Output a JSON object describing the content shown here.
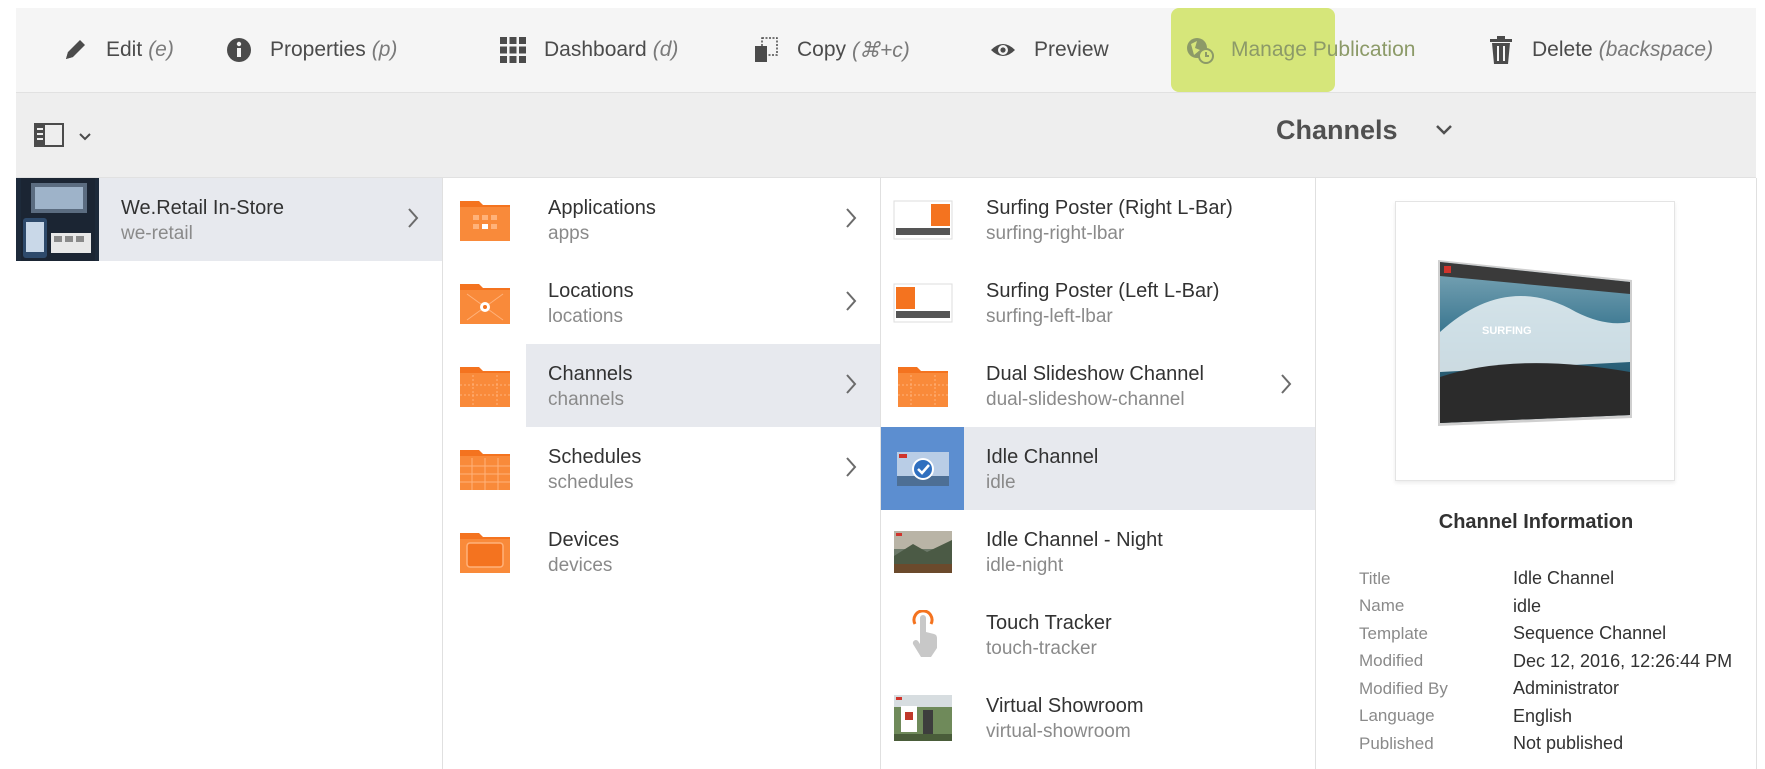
{
  "toolbar": {
    "items": [
      {
        "label": "Edit",
        "shortcut": "(e)",
        "icon": "pencil-icon"
      },
      {
        "label": "Properties",
        "shortcut": "(p)",
        "icon": "info-icon"
      },
      {
        "label": "Dashboard",
        "shortcut": "(d)",
        "icon": "grid-icon"
      },
      {
        "label": "Copy",
        "shortcut": "(⌘+c)",
        "icon": "copy-icon"
      },
      {
        "label": "Preview",
        "shortcut": "",
        "icon": "eye-icon"
      },
      {
        "label": "Manage Publication",
        "shortcut": "",
        "icon": "publication-icon"
      },
      {
        "label": "Delete",
        "shortcut": "(backspace)",
        "icon": "trash-icon"
      }
    ],
    "highlight_color": "#d6e67a"
  },
  "subheader": {
    "title": "Channels",
    "rail_icon": "rail-toggle-icon"
  },
  "columns": {
    "root": [
      {
        "title": "We.Retail In-Store",
        "name": "we-retail"
      }
    ],
    "level2": [
      {
        "title": "Applications",
        "name": "apps"
      },
      {
        "title": "Locations",
        "name": "locations"
      },
      {
        "title": "Channels",
        "name": "channels"
      },
      {
        "title": "Schedules",
        "name": "schedules"
      },
      {
        "title": "Devices",
        "name": "devices"
      }
    ],
    "level3": [
      {
        "title": "Surfing Poster (Right L-Bar)",
        "name": "surfing-right-lbar"
      },
      {
        "title": "Surfing Poster (Left L-Bar)",
        "name": "surfing-left-lbar"
      },
      {
        "title": "Dual Slideshow Channel",
        "name": "dual-slideshow-channel"
      },
      {
        "title": "Idle Channel",
        "name": "idle"
      },
      {
        "title": "Idle Channel - Night",
        "name": "idle-night"
      },
      {
        "title": "Touch Tracker",
        "name": "touch-tracker"
      },
      {
        "title": "Virtual Showroom",
        "name": "virtual-showroom"
      }
    ]
  },
  "preview": {
    "banner_text": "SURFING"
  },
  "info": {
    "heading": "Channel Information",
    "properties": [
      {
        "key": "Title",
        "value": "Idle Channel"
      },
      {
        "key": "Name",
        "value": "idle"
      },
      {
        "key": "Template",
        "value": "Sequence Channel"
      },
      {
        "key": "Modified",
        "value": "Dec 12, 2016, 12:26:44 PM"
      },
      {
        "key": "Modified By",
        "value": "Administrator"
      },
      {
        "key": "Language",
        "value": "English"
      },
      {
        "key": "Published",
        "value": "Not published"
      }
    ]
  },
  "colors": {
    "folder_orange": "#f4731f",
    "selection_row": "#e7e9ee",
    "selected_thumb": "#5c8ed0"
  }
}
